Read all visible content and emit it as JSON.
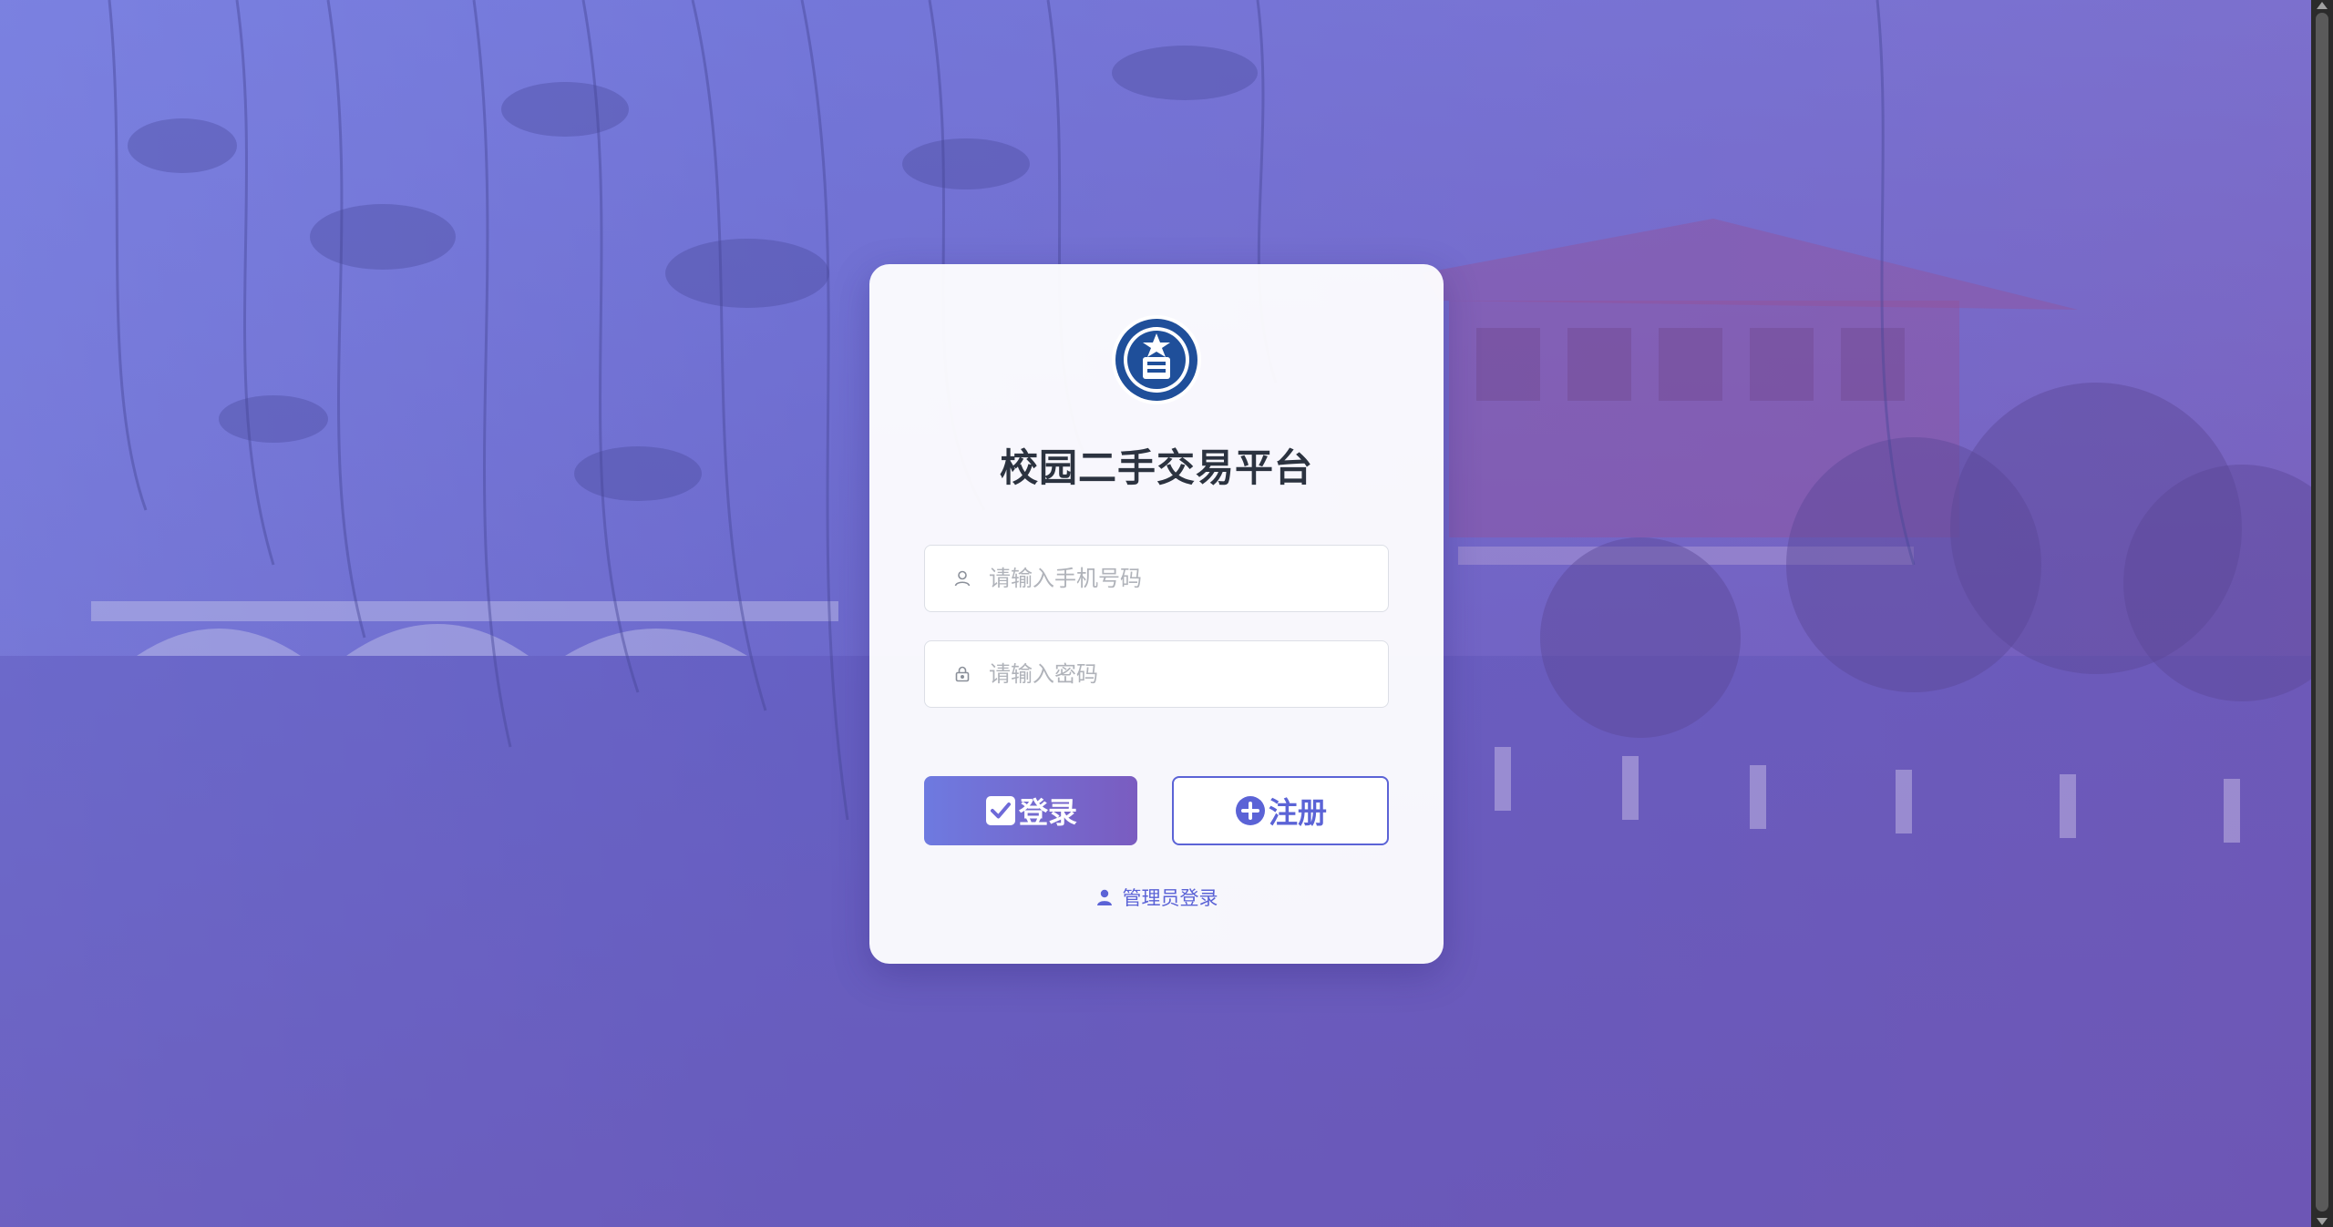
{
  "page": {
    "title": "校园二手交易平台"
  },
  "form": {
    "phone_placeholder": "请输入手机号码",
    "password_placeholder": "请输入密码",
    "phone_value": "",
    "password_value": ""
  },
  "buttons": {
    "login_label": "登录",
    "register_label": "注册"
  },
  "links": {
    "admin_login": "管理员登录"
  },
  "icons": {
    "logo": "university-seal-logo",
    "phone_field": "user-icon",
    "password_field": "lock-icon",
    "login_button": "checkbox-checked-icon",
    "register_button": "plus-circle-icon",
    "admin_link": "user-filled-icon"
  },
  "colors": {
    "accent": "#5b63d6",
    "login_gradient_start": "#6e7ae0",
    "login_gradient_end": "#7a5cc0",
    "title_text": "#2c3340",
    "placeholder_text": "#b0b3ba"
  }
}
